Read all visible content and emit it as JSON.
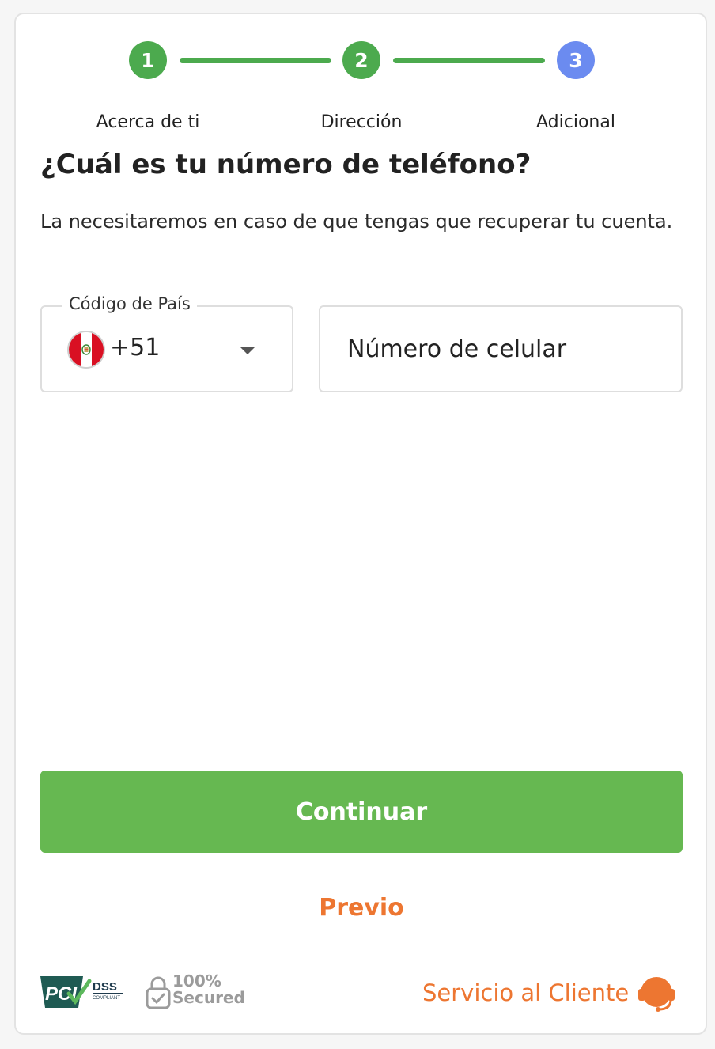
{
  "stepper": {
    "steps": [
      {
        "number": "1",
        "label": "Acerca de ti",
        "status": "completed"
      },
      {
        "number": "2",
        "label": "Dirección",
        "status": "completed"
      },
      {
        "number": "3",
        "label": "Adicional",
        "status": "active"
      }
    ],
    "colors": {
      "completed": "#4caa4e",
      "active": "#6b8bf0"
    }
  },
  "form": {
    "title": "¿Cuál es tu número de teléfono?",
    "subtitle": "La necesitaremos en caso de que tengas que recuperar tu cuenta.",
    "country_code": {
      "legend": "Código de País",
      "value": "+51",
      "flag_icon": "peru-flag-icon"
    },
    "phone": {
      "placeholder": "Número de celular",
      "value": ""
    }
  },
  "actions": {
    "continue_label": "Continuar",
    "previous_label": "Previo"
  },
  "footer": {
    "pci_text": "PCI",
    "pci_dss": "DSS",
    "pci_compliant": "COMPLIANT",
    "secured_line1": "100%",
    "secured_line2": "Secured",
    "support_label": "Servicio al Cliente",
    "support_icon": "headset-icon"
  },
  "colors": {
    "primary_green": "#66b851",
    "accent_orange": "#ed7631"
  }
}
